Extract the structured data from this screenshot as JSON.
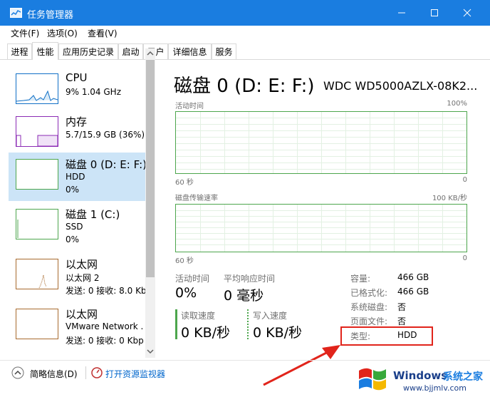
{
  "window": {
    "title": "任务管理器",
    "accent": "#1a7de0"
  },
  "menu": [
    "文件(F)",
    "选项(O)",
    "查看(V)"
  ],
  "tabs": [
    "进程",
    "性能",
    "应用历史记录",
    "启动",
    "用户",
    "详细信息",
    "服务"
  ],
  "active_tab": "性能",
  "sidebar": {
    "items": [
      {
        "title": "CPU",
        "line1": "9% 1.04 GHz",
        "line2": "",
        "color": "#1170c6"
      },
      {
        "title": "内存",
        "line1": "5.7/15.9 GB (36%)",
        "line2": "",
        "color": "#8b2bb5"
      },
      {
        "title": "磁盘 0 (D: E: F:)",
        "line1": "HDD",
        "line2": "0%",
        "color": "#4da64d"
      },
      {
        "title": "磁盘 1 (C:)",
        "line1": "SSD",
        "line2": "0%",
        "color": "#4da64d"
      },
      {
        "title": "以太网",
        "line1": "以太网 2",
        "line2": "发送: 0 接收: 8.0 Kb",
        "color": "#a86a2e"
      },
      {
        "title": "以太网",
        "line1": "VMware Network .",
        "line2": "发送: 0 接收: 0 Kbp",
        "color": "#a86a2e"
      }
    ]
  },
  "main": {
    "title": "磁盘 0 (D: E: F:)",
    "model": "WDC WD5000AZLX-08K2...",
    "graph1": {
      "label": "活动时间",
      "max": "100%",
      "time": "60 秒",
      "min": "0"
    },
    "graph2": {
      "label": "磁盘传输速率",
      "max": "100 KB/秒",
      "time": "60 秒",
      "min": "0"
    },
    "stats": {
      "active_time_label": "活动时间",
      "active_time_value": "0%",
      "resp_label": "平均响应时间",
      "resp_value": "0 毫秒",
      "read_label": "读取速度",
      "read_value": "0 KB/秒",
      "write_label": "写入速度",
      "write_value": "0 KB/秒"
    },
    "info": [
      {
        "label": "容量:",
        "value": "466 GB"
      },
      {
        "label": "已格式化:",
        "value": "466 GB"
      },
      {
        "label": "系统磁盘:",
        "value": "否"
      },
      {
        "label": "页面文件:",
        "value": "否"
      },
      {
        "label": "类型:",
        "value": "HDD"
      }
    ]
  },
  "footer": {
    "fewer_details": "简略信息(D)",
    "open_monitor": "打开资源监视器"
  },
  "watermark": {
    "brand": "Windows",
    "brand2": "系统之家",
    "url": "www.bjjmlv.com"
  }
}
